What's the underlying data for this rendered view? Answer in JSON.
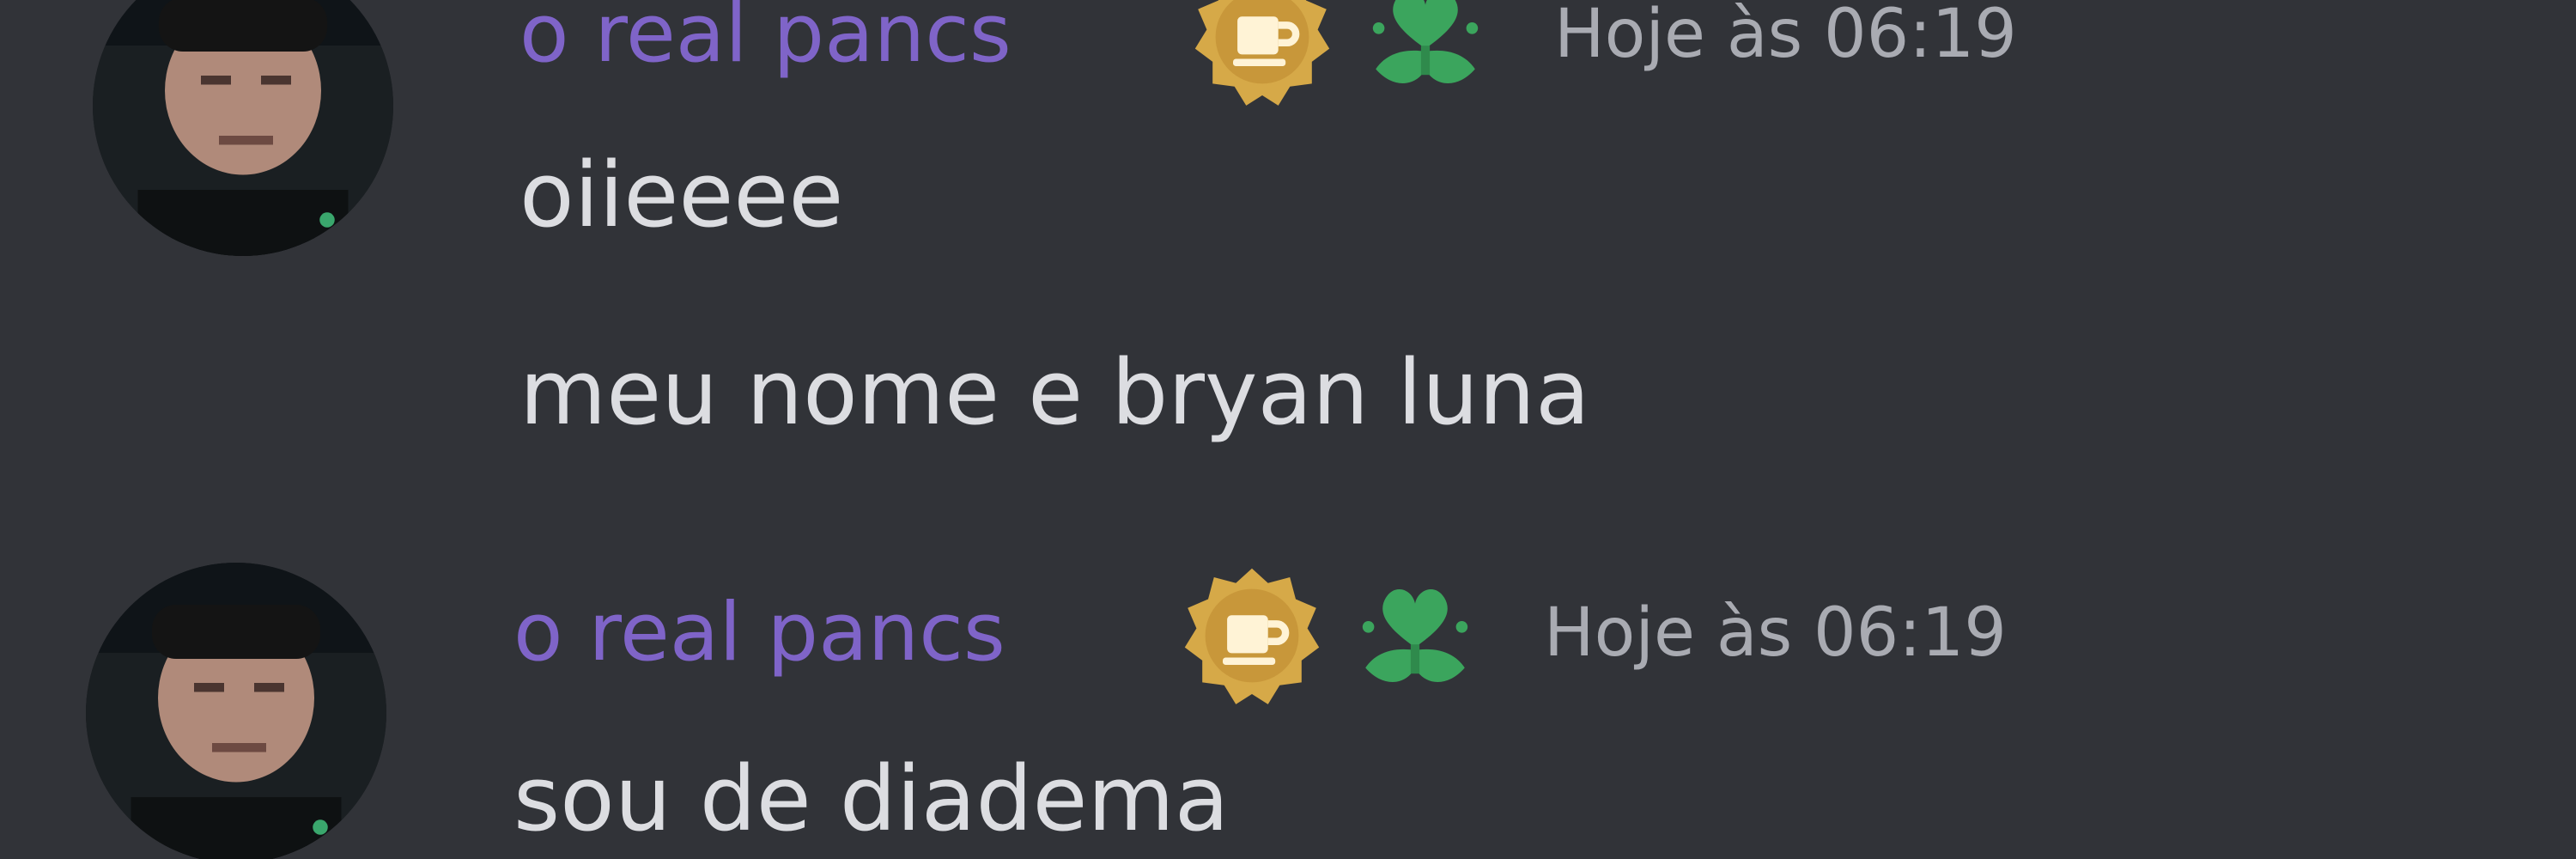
{
  "colors": {
    "background": "#313338",
    "username": "#7f64c8",
    "timestamp": "#a9abb2",
    "message_text": "#dcdde1",
    "badge_gold": "#d6a948",
    "badge_green": "#3ba55d"
  },
  "messages": [
    {
      "author": {
        "name": "o real pancs",
        "avatar_icon": "user-avatar",
        "badges": [
          {
            "icon": "coffee-badge-icon"
          },
          {
            "icon": "heart-sprout-badge-icon"
          }
        ]
      },
      "timestamp": "Hoje às 06:19",
      "lines": [
        "oiieeee",
        "meu nome e bryan luna"
      ]
    },
    {
      "author": {
        "name": "o real pancs",
        "avatar_icon": "user-avatar",
        "badges": [
          {
            "icon": "coffee-badge-icon"
          },
          {
            "icon": "heart-sprout-badge-icon"
          }
        ]
      },
      "timestamp": "Hoje às 06:19",
      "lines": [
        "sou de diadema"
      ]
    }
  ]
}
